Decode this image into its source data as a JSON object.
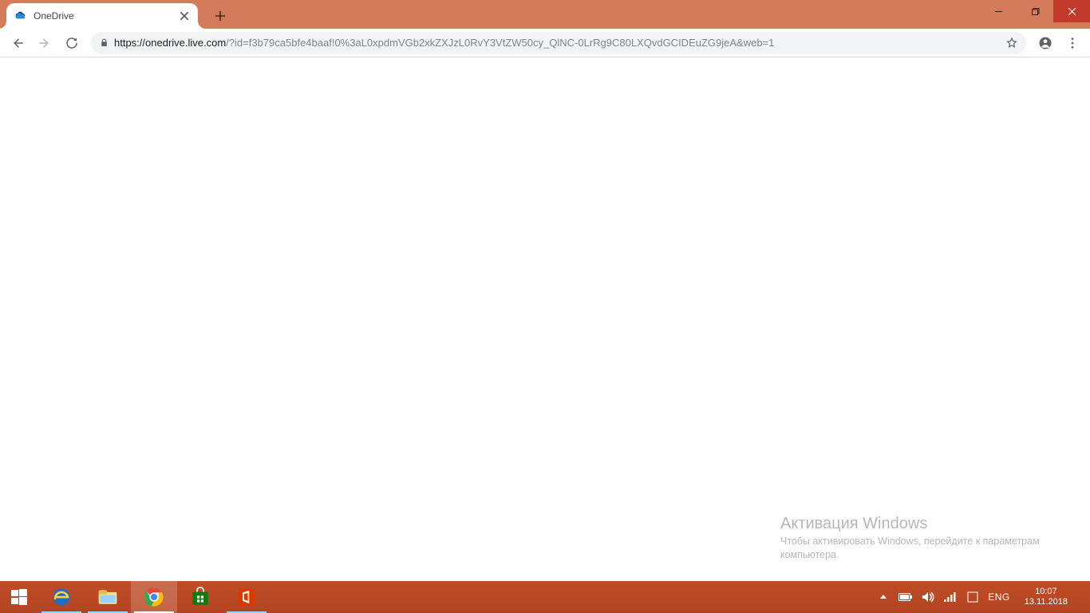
{
  "browser": {
    "tab_title": "OneDrive",
    "url_host": "https://onedrive.live.com",
    "url_path": "/?id=f3b79ca5bfe4baaf!0%3aL0xpdmVGb2xkZXJzL0RvY3VtZW50cy_QlNC-0LrRg9C80LXQvdGCIDEuZG9jeA&web=1"
  },
  "watermark": {
    "title": "Активация Windows",
    "subtitle": "Чтобы активировать Windows, перейдите к параметрам компьютера."
  },
  "tray": {
    "lang": "ENG",
    "time": "10:07",
    "date": "13.11.2018"
  }
}
